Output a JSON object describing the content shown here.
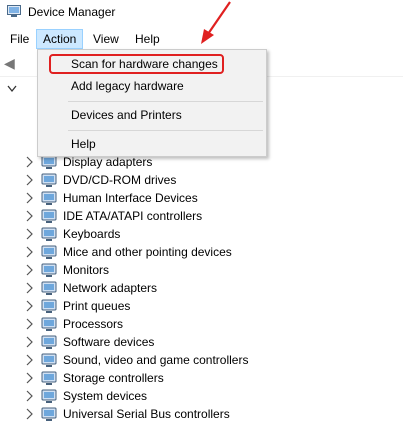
{
  "window": {
    "title": "Device Manager"
  },
  "menubar": {
    "items": [
      "File",
      "Action",
      "View",
      "Help"
    ]
  },
  "action_menu": {
    "items": [
      "Scan for hardware changes",
      "Add legacy hardware",
      "Devices and Printers",
      "Help"
    ]
  },
  "tree": {
    "visible_items": [
      {
        "label": "Display adapters",
        "icon": "display-adapter-icon"
      },
      {
        "label": "DVD/CD-ROM drives",
        "icon": "dvd-drive-icon"
      },
      {
        "label": "Human Interface Devices",
        "icon": "hid-icon"
      },
      {
        "label": "IDE ATA/ATAPI controllers",
        "icon": "ide-controller-icon"
      },
      {
        "label": "Keyboards",
        "icon": "keyboard-icon"
      },
      {
        "label": "Mice and other pointing devices",
        "icon": "mouse-icon"
      },
      {
        "label": "Monitors",
        "icon": "monitor-icon"
      },
      {
        "label": "Network adapters",
        "icon": "network-adapter-icon"
      },
      {
        "label": "Print queues",
        "icon": "printer-icon"
      },
      {
        "label": "Processors",
        "icon": "processor-icon"
      },
      {
        "label": "Software devices",
        "icon": "software-device-icon"
      },
      {
        "label": "Sound, video and game controllers",
        "icon": "sound-icon"
      },
      {
        "label": "Storage controllers",
        "icon": "storage-controller-icon"
      },
      {
        "label": "System devices",
        "icon": "system-devices-icon"
      },
      {
        "label": "Universal Serial Bus controllers",
        "icon": "usb-icon"
      }
    ]
  },
  "colors": {
    "highlight": "#e02020",
    "menu_active": "#cce8ff",
    "menu_bg": "#f2f2f2"
  }
}
